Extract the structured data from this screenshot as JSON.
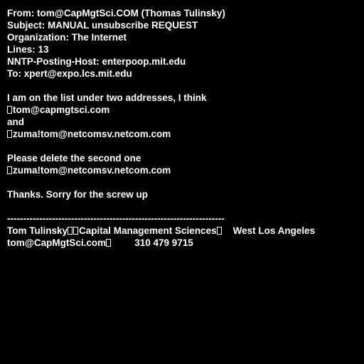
{
  "header": {
    "from": "From: tom@CapMgtSci.COM (Thomas Tulinsky)",
    "subject": "Subject: MANUAL unsubscribe REQUEST",
    "organization": "Organization: The Internet",
    "lines": "Lines: 13",
    "nntp_posting_host": "NNTP-Posting-Host: enterpoop.mit.edu",
    "to": "To: xpert@expo.lcs.mit.edu"
  },
  "body": {
    "intro": "I am on the list under two addresses, I think",
    "address_1": "tom@capmgtsci.com",
    "and": "and",
    "address_2": "zuma!tom@netcomsv.netcom.com",
    "request": "Please delete the second one",
    "address_repeat": "zuma!tom@netcomsv.netcom.com",
    "thanks": "Thanks. Sorry for the screw up"
  },
  "signature": {
    "separator": "------------------------------------------------------------------------",
    "name": "Tom Tulinsky",
    "company": "Capital Management Sciences",
    "location": "West Los Angeles",
    "email": "tom@CapMgtSci.com",
    "phone": "310 479 9715"
  }
}
